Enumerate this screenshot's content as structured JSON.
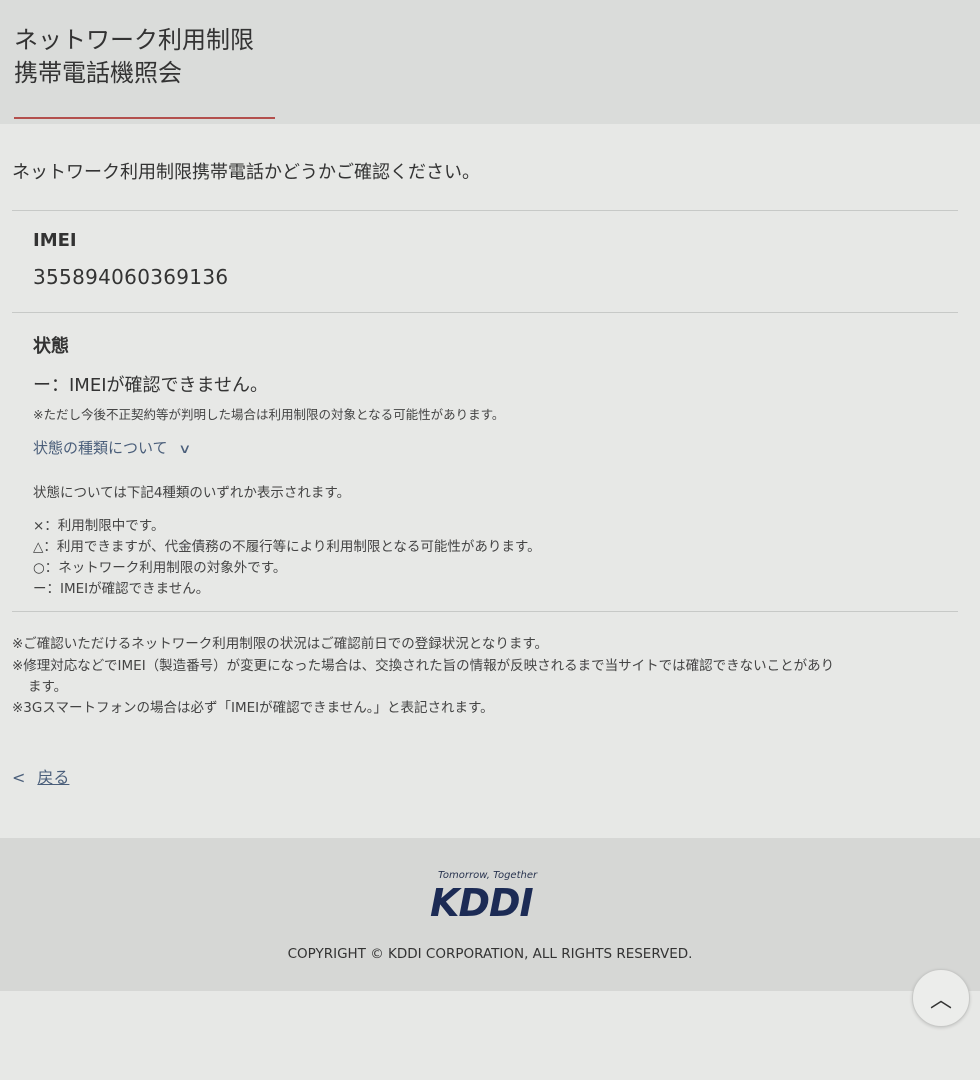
{
  "header": {
    "title_line1": "ネットワーク利用制限",
    "title_line2": "携帯電話機照会"
  },
  "intro": "ネットワーク利用制限携帯電話かどうかご確認ください。",
  "imei": {
    "label": "IMEI",
    "value": "355894060369136"
  },
  "status": {
    "label": "状態",
    "value": "ー：IMEIが確認できません。",
    "caveat": "※ただし今後不正契約等が判明した場合は利用制限の対象となる可能性があります。",
    "toggle_label": "状態の種類について",
    "toggle_icon": "chevron-down-icon",
    "legend_intro": "状態については下記4種類のいずれか表示されます。",
    "legend": [
      "×：利用制限中です。",
      "△：利用できますが、代金債務の不履行等により利用制限となる可能性があります。",
      "○：ネットワーク利用制限の対象外です。",
      "ー：IMEIが確認できません。"
    ]
  },
  "notes": [
    "※ご確認いただけるネットワーク利用制限の状況はご確認前日での登録状況となります。",
    "※修理対応などでIMEI（製造番号）が変更になった場合は、交換された旨の情報が反映されるまで当サイトでは確認できないことがあり",
    "ます。",
    "※3Gスマートフォンの場合は必ず「IMEIが確認できません。」と表記されます。"
  ],
  "back": {
    "icon": "chevron-left-icon",
    "label": "戻る"
  },
  "footer": {
    "logo_tagline": "Tomorrow, Together",
    "logo_text": "KDDI",
    "copyright": "COPYRIGHT © KDDI CORPORATION, ALL RIGHTS RESERVED."
  },
  "scroll_top_icon": "chevron-up-icon",
  "colors": {
    "accent_underline": "#b3504d",
    "link": "#4a5e7a",
    "logo": "#1c2b55"
  }
}
